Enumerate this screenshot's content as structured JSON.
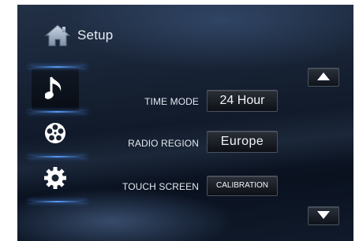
{
  "header": {
    "title": "Setup",
    "icon": "home-icon"
  },
  "sidebar": {
    "items": [
      {
        "name": "music",
        "icon": "music-note-icon",
        "selected": true
      },
      {
        "name": "video",
        "icon": "film-reel-icon",
        "selected": false
      },
      {
        "name": "settings",
        "icon": "gear-icon",
        "selected": false
      }
    ]
  },
  "settings": {
    "time_mode": {
      "label": "TIME MODE",
      "value": "24 Hour"
    },
    "radio_region": {
      "label": "RADIO REGION",
      "value": "Europe"
    },
    "touch_screen": {
      "label": "TOUCH SCREEN",
      "value": "CALIBRATION"
    }
  },
  "scroll": {
    "up_icon": "triangle-up-icon",
    "down_icon": "triangle-down-icon"
  },
  "colors": {
    "accent_glow": "#5aa0ff",
    "text": "#e4e9f0"
  }
}
